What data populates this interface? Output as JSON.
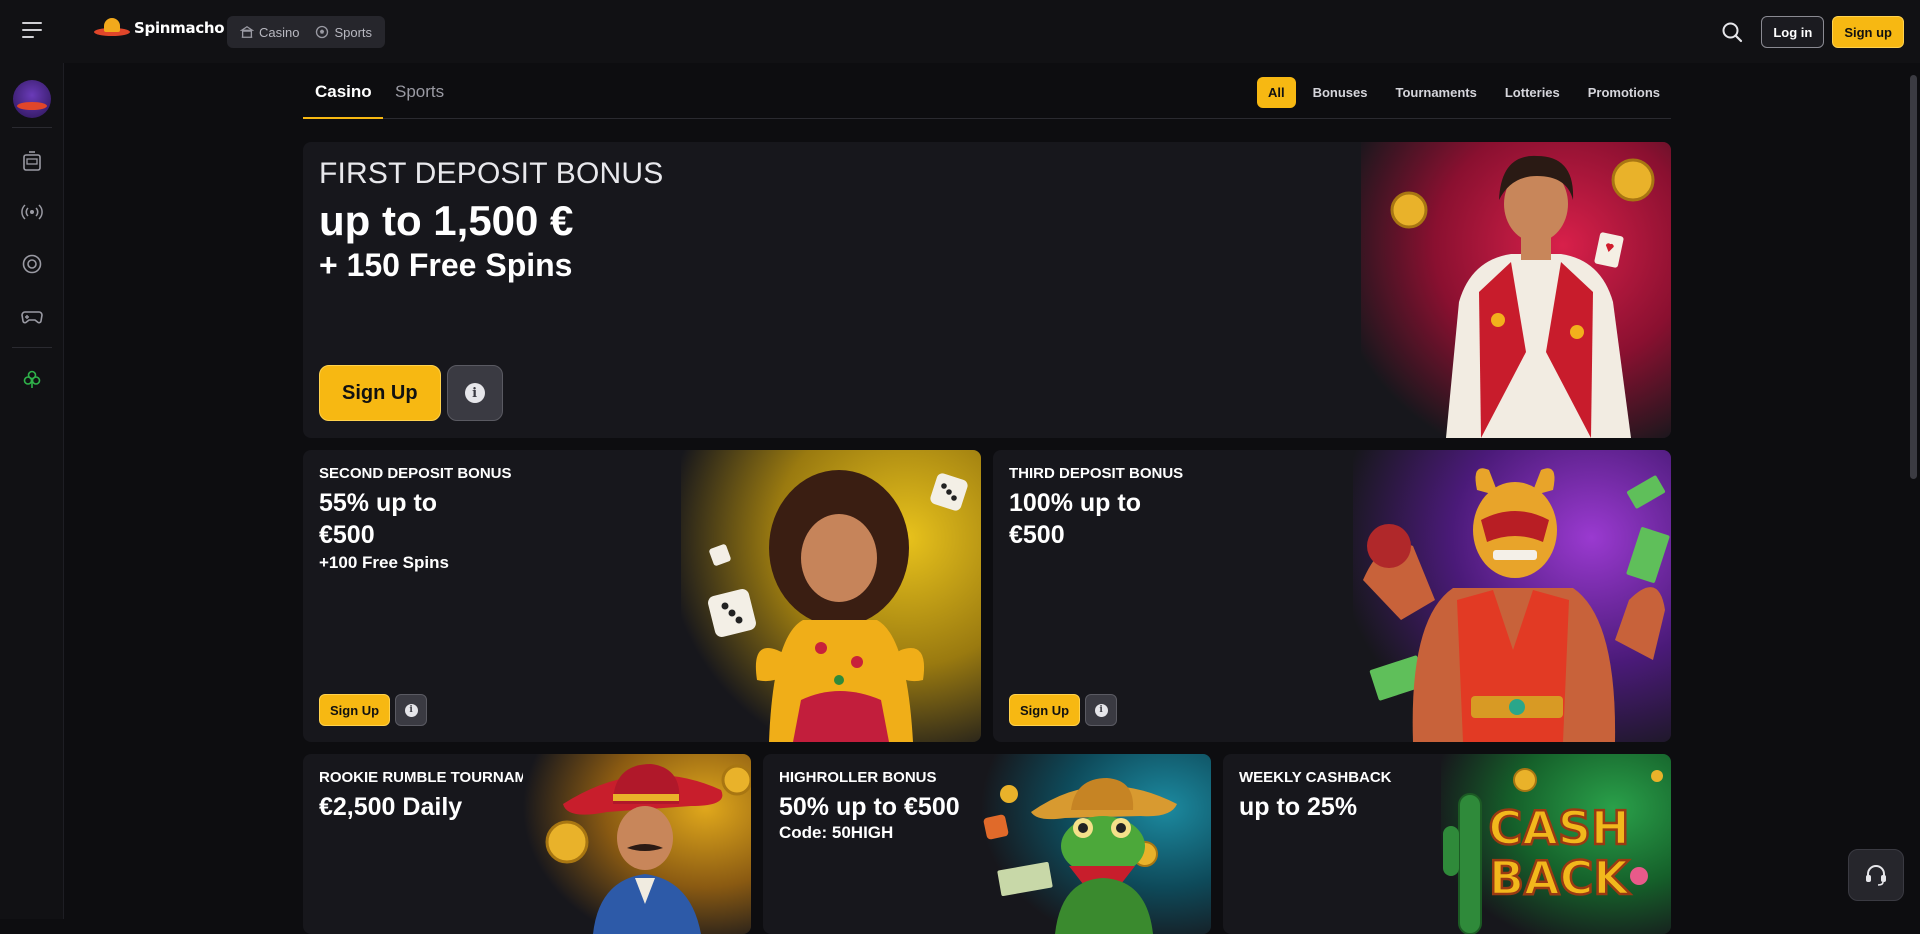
{
  "brand": {
    "name": "Spinmacho"
  },
  "topbar": {
    "modes": [
      {
        "label": "Casino",
        "icon": "casino-building-icon"
      },
      {
        "label": "Sports",
        "icon": "soccer-ball-icon"
      }
    ],
    "login_label": "Log in",
    "signup_label": "Sign up"
  },
  "sidebar": {
    "items": [
      {
        "icon": "avatar-mascot-icon"
      },
      {
        "icon": "slot-machine-icon"
      },
      {
        "icon": "live-broadcast-icon"
      },
      {
        "icon": "poker-chip-icon"
      },
      {
        "icon": "gamepad-icon"
      },
      {
        "icon": "clover-icon"
      }
    ]
  },
  "subnav": {
    "tabs": [
      {
        "label": "Casino",
        "active": true
      },
      {
        "label": "Sports",
        "active": false
      }
    ],
    "filters": [
      "All",
      "Bonuses",
      "Tournaments",
      "Lotteries",
      "Promotions"
    ],
    "active_filter": "All"
  },
  "hero": {
    "eyebrow": "FIRST DEPOSIT BONUS",
    "line1": "up to 1,500 €",
    "line2": "+ 150 Free Spins",
    "cta": "Sign Up"
  },
  "promos": [
    {
      "eyebrow": "SECOND DEPOSIT BONUS",
      "line1a": "55% up to",
      "line1b": "€500",
      "line2": "+100 Free Spins",
      "cta": "Sign Up"
    },
    {
      "eyebrow": "THIRD DEPOSIT BONUS",
      "line1a": "100% up to",
      "line1b": "€500",
      "line2": "",
      "cta": "Sign Up"
    }
  ],
  "bottom_cards": [
    {
      "eyebrow": "ROOKIE RUMBLE TOURNAMENT",
      "line1": "€2,500 Daily",
      "line2": ""
    },
    {
      "eyebrow": "HIGHROLLER BONUS",
      "line1": "50% up to €500",
      "line2": "Code: 50HIGH"
    },
    {
      "eyebrow": "WEEKLY CASHBACK",
      "line1": "up to 25%",
      "line2": "",
      "art_text": [
        "CASH",
        "BACK"
      ]
    }
  ],
  "colors": {
    "accent": "#f7b812",
    "background": "#0d0d10",
    "card": "#17171c",
    "sidebar": "#111114"
  }
}
